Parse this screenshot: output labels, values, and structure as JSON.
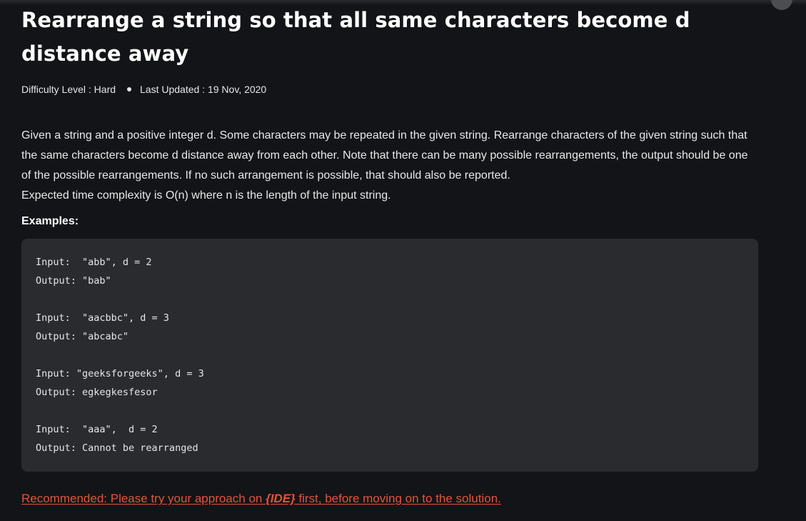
{
  "article": {
    "title": "Rearrange a string so that all same characters become d distance away",
    "difficulty": "Difficulty Level : Hard",
    "last_updated": "Last Updated : 19 Nov, 2020",
    "description": [
      "Given a string and a positive integer d. Some characters may be repeated in the given string. Rearrange characters of the given string such that the same characters become d distance away from each other. Note that there can be many possible rearrangements, the output should be one of the possible rearrangements. If no such arrangement is possible, that should also be reported.",
      "Expected time complexity is O(n) where n is the length of the input string."
    ],
    "examples_label": "Examples:",
    "examples": [
      {
        "input": "Input:  \"abb\", d = 2",
        "output": "Output: \"bab\""
      },
      {
        "input": "Input:  \"aacbbc\", d = 3",
        "output": "Output: \"abcabc\""
      },
      {
        "input": "Input: \"geeksforgeeks\", d = 3",
        "output": "Output: egkegkesfesor"
      },
      {
        "input": "Input:  \"aaa\",  d = 2",
        "output": "Output: Cannot be rearranged"
      }
    ],
    "recommend": {
      "before": "Recommended: Please try your approach on ",
      "ide": "{IDE}",
      "after": " first, before moving on to the solution."
    }
  },
  "colors": {
    "background": "#131417",
    "code_background": "#2a2b2e",
    "link": "#e0553c"
  }
}
